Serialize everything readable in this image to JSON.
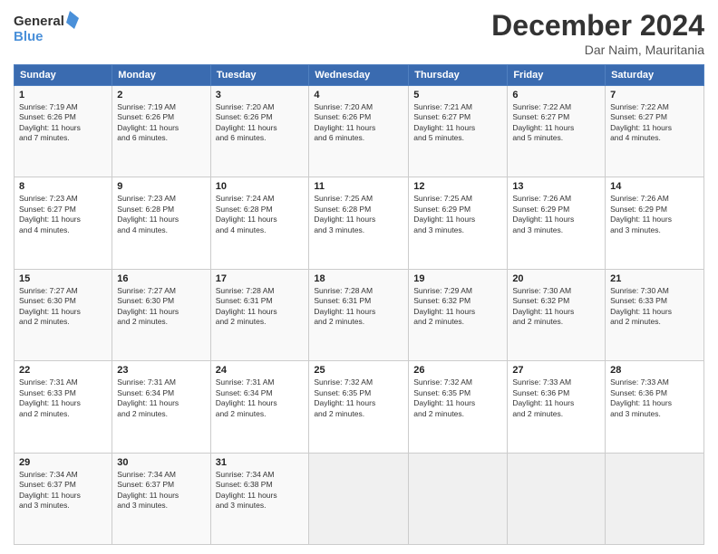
{
  "header": {
    "logo_line1": "General",
    "logo_line2": "Blue",
    "month_title": "December 2024",
    "location": "Dar Naim, Mauritania"
  },
  "weekdays": [
    "Sunday",
    "Monday",
    "Tuesday",
    "Wednesday",
    "Thursday",
    "Friday",
    "Saturday"
  ],
  "weeks": [
    [
      {
        "day": "1",
        "info": "Sunrise: 7:19 AM\nSunset: 6:26 PM\nDaylight: 11 hours\nand 7 minutes."
      },
      {
        "day": "2",
        "info": "Sunrise: 7:19 AM\nSunset: 6:26 PM\nDaylight: 11 hours\nand 6 minutes."
      },
      {
        "day": "3",
        "info": "Sunrise: 7:20 AM\nSunset: 6:26 PM\nDaylight: 11 hours\nand 6 minutes."
      },
      {
        "day": "4",
        "info": "Sunrise: 7:20 AM\nSunset: 6:26 PM\nDaylight: 11 hours\nand 6 minutes."
      },
      {
        "day": "5",
        "info": "Sunrise: 7:21 AM\nSunset: 6:27 PM\nDaylight: 11 hours\nand 5 minutes."
      },
      {
        "day": "6",
        "info": "Sunrise: 7:22 AM\nSunset: 6:27 PM\nDaylight: 11 hours\nand 5 minutes."
      },
      {
        "day": "7",
        "info": "Sunrise: 7:22 AM\nSunset: 6:27 PM\nDaylight: 11 hours\nand 4 minutes."
      }
    ],
    [
      {
        "day": "8",
        "info": "Sunrise: 7:23 AM\nSunset: 6:27 PM\nDaylight: 11 hours\nand 4 minutes."
      },
      {
        "day": "9",
        "info": "Sunrise: 7:23 AM\nSunset: 6:28 PM\nDaylight: 11 hours\nand 4 minutes."
      },
      {
        "day": "10",
        "info": "Sunrise: 7:24 AM\nSunset: 6:28 PM\nDaylight: 11 hours\nand 4 minutes."
      },
      {
        "day": "11",
        "info": "Sunrise: 7:25 AM\nSunset: 6:28 PM\nDaylight: 11 hours\nand 3 minutes."
      },
      {
        "day": "12",
        "info": "Sunrise: 7:25 AM\nSunset: 6:29 PM\nDaylight: 11 hours\nand 3 minutes."
      },
      {
        "day": "13",
        "info": "Sunrise: 7:26 AM\nSunset: 6:29 PM\nDaylight: 11 hours\nand 3 minutes."
      },
      {
        "day": "14",
        "info": "Sunrise: 7:26 AM\nSunset: 6:29 PM\nDaylight: 11 hours\nand 3 minutes."
      }
    ],
    [
      {
        "day": "15",
        "info": "Sunrise: 7:27 AM\nSunset: 6:30 PM\nDaylight: 11 hours\nand 2 minutes."
      },
      {
        "day": "16",
        "info": "Sunrise: 7:27 AM\nSunset: 6:30 PM\nDaylight: 11 hours\nand 2 minutes."
      },
      {
        "day": "17",
        "info": "Sunrise: 7:28 AM\nSunset: 6:31 PM\nDaylight: 11 hours\nand 2 minutes."
      },
      {
        "day": "18",
        "info": "Sunrise: 7:28 AM\nSunset: 6:31 PM\nDaylight: 11 hours\nand 2 minutes."
      },
      {
        "day": "19",
        "info": "Sunrise: 7:29 AM\nSunset: 6:32 PM\nDaylight: 11 hours\nand 2 minutes."
      },
      {
        "day": "20",
        "info": "Sunrise: 7:30 AM\nSunset: 6:32 PM\nDaylight: 11 hours\nand 2 minutes."
      },
      {
        "day": "21",
        "info": "Sunrise: 7:30 AM\nSunset: 6:33 PM\nDaylight: 11 hours\nand 2 minutes."
      }
    ],
    [
      {
        "day": "22",
        "info": "Sunrise: 7:31 AM\nSunset: 6:33 PM\nDaylight: 11 hours\nand 2 minutes."
      },
      {
        "day": "23",
        "info": "Sunrise: 7:31 AM\nSunset: 6:34 PM\nDaylight: 11 hours\nand 2 minutes."
      },
      {
        "day": "24",
        "info": "Sunrise: 7:31 AM\nSunset: 6:34 PM\nDaylight: 11 hours\nand 2 minutes."
      },
      {
        "day": "25",
        "info": "Sunrise: 7:32 AM\nSunset: 6:35 PM\nDaylight: 11 hours\nand 2 minutes."
      },
      {
        "day": "26",
        "info": "Sunrise: 7:32 AM\nSunset: 6:35 PM\nDaylight: 11 hours\nand 2 minutes."
      },
      {
        "day": "27",
        "info": "Sunrise: 7:33 AM\nSunset: 6:36 PM\nDaylight: 11 hours\nand 2 minutes."
      },
      {
        "day": "28",
        "info": "Sunrise: 7:33 AM\nSunset: 6:36 PM\nDaylight: 11 hours\nand 3 minutes."
      }
    ],
    [
      {
        "day": "29",
        "info": "Sunrise: 7:34 AM\nSunset: 6:37 PM\nDaylight: 11 hours\nand 3 minutes."
      },
      {
        "day": "30",
        "info": "Sunrise: 7:34 AM\nSunset: 6:37 PM\nDaylight: 11 hours\nand 3 minutes."
      },
      {
        "day": "31",
        "info": "Sunrise: 7:34 AM\nSunset: 6:38 PM\nDaylight: 11 hours\nand 3 minutes."
      },
      {
        "day": "",
        "info": ""
      },
      {
        "day": "",
        "info": ""
      },
      {
        "day": "",
        "info": ""
      },
      {
        "day": "",
        "info": ""
      }
    ]
  ]
}
